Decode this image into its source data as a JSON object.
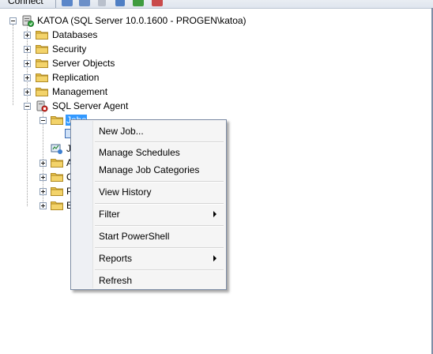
{
  "toolbar": {
    "connect_label": "Connect"
  },
  "tree": {
    "root": {
      "label": "KATOA (SQL Server 10.0.1600 - PROGEN\\katoa)"
    },
    "items": [
      {
        "label": "Databases"
      },
      {
        "label": "Security"
      },
      {
        "label": "Server Objects"
      },
      {
        "label": "Replication"
      },
      {
        "label": "Management"
      },
      {
        "label": "SQL Server Agent"
      }
    ],
    "agent_children": [
      {
        "label": "Jobs"
      },
      {
        "label": "J"
      },
      {
        "label": "A"
      },
      {
        "label": "O"
      },
      {
        "label": "P"
      },
      {
        "label": "E"
      }
    ]
  },
  "context_menu": {
    "items": [
      {
        "label": "New Job..."
      },
      {
        "label": "Manage Schedules"
      },
      {
        "label": "Manage Job Categories"
      },
      {
        "label": "View History"
      },
      {
        "label": "Filter"
      },
      {
        "label": "Start PowerShell"
      },
      {
        "label": "Reports"
      },
      {
        "label": "Refresh"
      }
    ]
  },
  "colors": {
    "folder": "#e8c34a",
    "selection": "#3399ff",
    "menu_background": "#f5f5f5"
  }
}
